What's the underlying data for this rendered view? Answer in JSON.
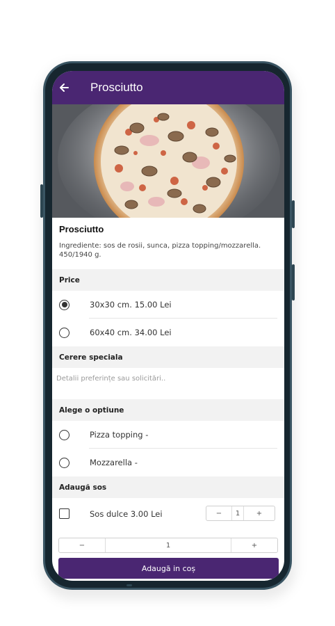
{
  "app_bar": {
    "title": "Prosciutto",
    "back_icon": "arrow-left-icon",
    "color": "#4a2672"
  },
  "product": {
    "name": "Prosciutto",
    "ingredients": "Ingrediente: sos de rosii, sunca, pizza topping/mozzarella. 450/1940 g."
  },
  "price_section": {
    "title": "Price",
    "options": [
      {
        "label": "30x30 cm.  15.00 Lei",
        "selected": true
      },
      {
        "label": "60x40 cm.  34.00 Lei",
        "selected": false
      }
    ]
  },
  "special_request": {
    "title": "Cerere speciala",
    "placeholder": "Detalii preferințe sau solicitări.."
  },
  "choice_section": {
    "title": "Alege o optiune",
    "options": [
      {
        "label": "Pizza topping  -",
        "selected": false
      },
      {
        "label": "Mozzarella  -",
        "selected": false
      }
    ]
  },
  "sauce_section": {
    "title": "Adaugă sos",
    "items": [
      {
        "label": "Sos dulce  3.00 Lei",
        "checked": false,
        "minus": "−",
        "quantity": "1",
        "plus": "+"
      }
    ]
  },
  "quantity": {
    "minus": "−",
    "value": "1",
    "plus": "+"
  },
  "add_to_cart": {
    "label": "Adaugă in coș",
    "color": "#4a2672"
  }
}
